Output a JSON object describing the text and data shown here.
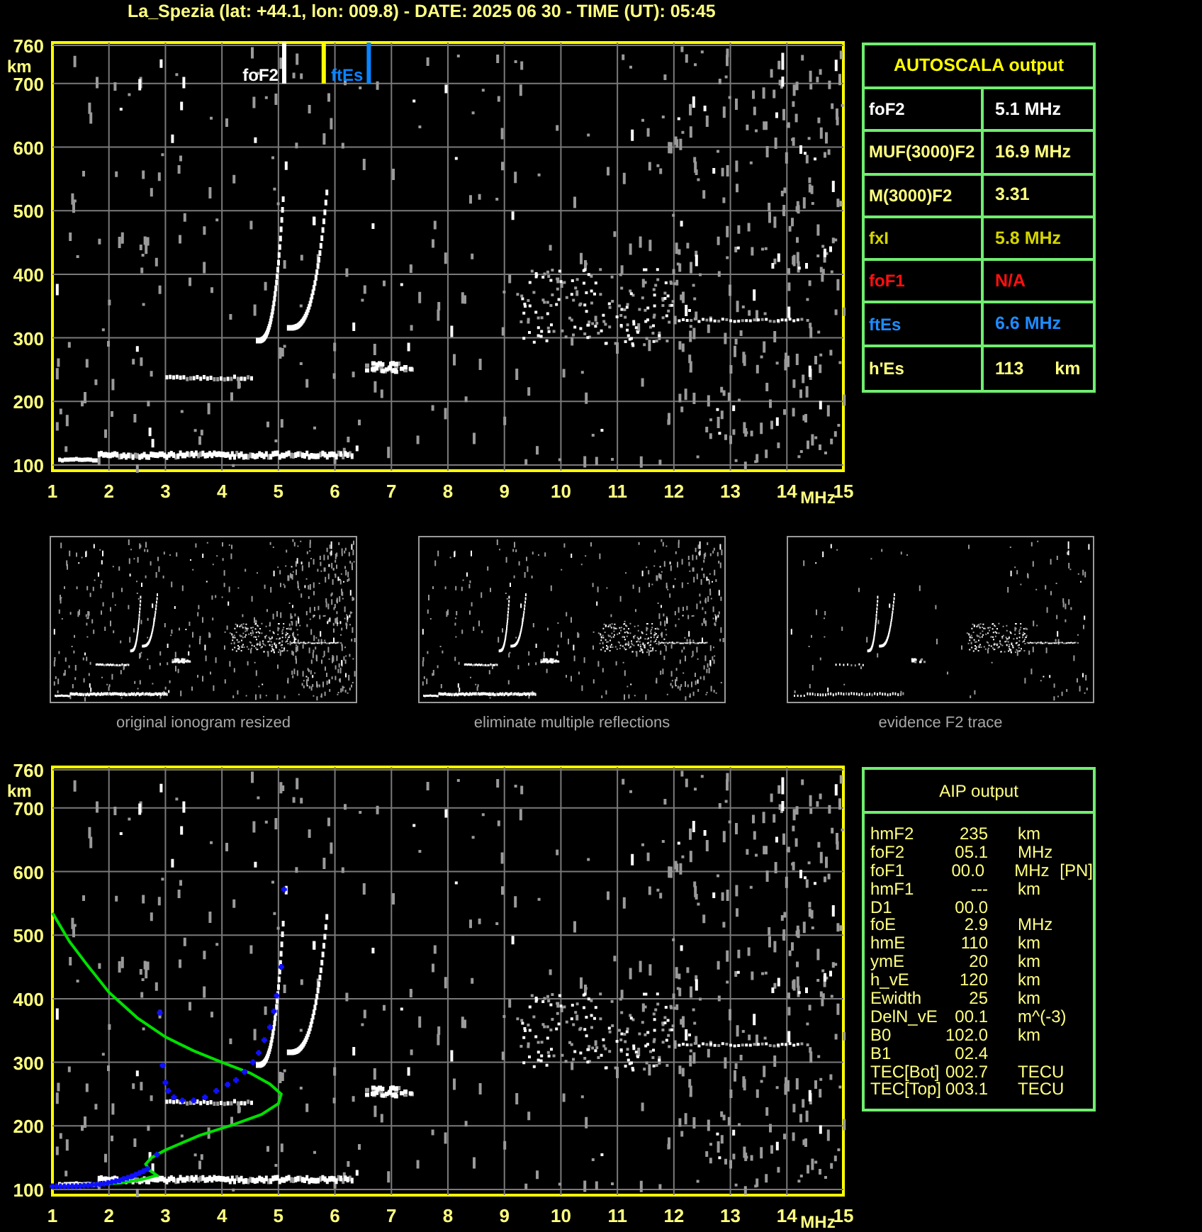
{
  "title": "La_Spezia (lat: +44.1, lon: 009.8) - DATE: 2025 06 30 - TIME (UT): 05:45",
  "ionogram": {
    "y_unit": "km",
    "x_unit": "MHz",
    "y_ticks": [
      "760",
      "700",
      "600",
      "500",
      "400",
      "300",
      "200",
      "100"
    ],
    "x_ticks": [
      "1",
      "2",
      "3",
      "4",
      "5",
      "6",
      "7",
      "8",
      "9",
      "10",
      "11",
      "12",
      "13",
      "14",
      "15"
    ],
    "markers": [
      {
        "label": "foF2",
        "color": "#ffffff",
        "level": 0.293
      },
      {
        "color": "#ffff00",
        "level": 0.343
      },
      {
        "label": "ftEs",
        "color": "#0a84ff",
        "level": 0.4
      }
    ]
  },
  "autoscala": {
    "title": "AUTOSCALA output",
    "rows": [
      {
        "name": "foF2",
        "value": "5.1 MHz",
        "color": "#ffffff"
      },
      {
        "name": "MUF(3000)F2",
        "value": "16.9 MHz",
        "color": "#ffff80"
      },
      {
        "name": "M(3000)F2",
        "value": "3.31",
        "color": "#ffff80"
      },
      {
        "name": "fxI",
        "value": "5.8 MHz",
        "color": "#d4d400"
      },
      {
        "name": "foF1",
        "value": "N/A",
        "color": "#ff1010"
      },
      {
        "name": "ftEs",
        "value": "6.6 MHz",
        "color": "#1e8cff"
      },
      {
        "name": "h'Es",
        "value": "113",
        "unit": "km",
        "color": "#ffff80"
      }
    ]
  },
  "thumbnails": [
    {
      "caption": "original ionogram resized"
    },
    {
      "caption": "eliminate multiple reflections"
    },
    {
      "caption": "evidence F2 trace"
    }
  ],
  "profile_ionogram": {
    "y_unit": "km",
    "x_unit": "MHz",
    "y_ticks": [
      "760",
      "700",
      "600",
      "500",
      "400",
      "300",
      "200",
      "100"
    ],
    "x_ticks": [
      "1",
      "2",
      "3",
      "4",
      "5",
      "6",
      "7",
      "8",
      "9",
      "10",
      "11",
      "12",
      "13",
      "14",
      "15"
    ]
  },
  "aip": {
    "title": "AIP output",
    "rows": [
      {
        "name": "hmF2",
        "value": "235",
        "unit": "km"
      },
      {
        "name": "foF2",
        "value": "05.1",
        "unit": "MHz"
      },
      {
        "name": "foF1",
        "value": "00.0",
        "unit": "MHz",
        "flag": "[PN]"
      },
      {
        "name": "hmF1",
        "value": "---",
        "unit": "km"
      },
      {
        "name": "D1",
        "value": "00.0"
      },
      {
        "name": "foE",
        "value": "2.9",
        "unit": "MHz"
      },
      {
        "name": "hmE",
        "value": "110",
        "unit": "km"
      },
      {
        "name": "ymE",
        "value": "20",
        "unit": "km"
      },
      {
        "name": "h_vE",
        "value": "120",
        "unit": "km"
      },
      {
        "name": "Ewidth",
        "value": "25",
        "unit": "km"
      },
      {
        "name": "DelN_vE",
        "value": "00.1",
        "unit": "m^(-3)"
      },
      {
        "name": "B0",
        "value": "102.0",
        "unit": "km"
      },
      {
        "name": "B1",
        "value": "02.4"
      },
      {
        "name": "TEC[Bot]",
        "value": "002.7",
        "unit": "TECU"
      },
      {
        "name": "TEC[Top]",
        "value": "003.1",
        "unit": "TECU"
      }
    ]
  }
}
